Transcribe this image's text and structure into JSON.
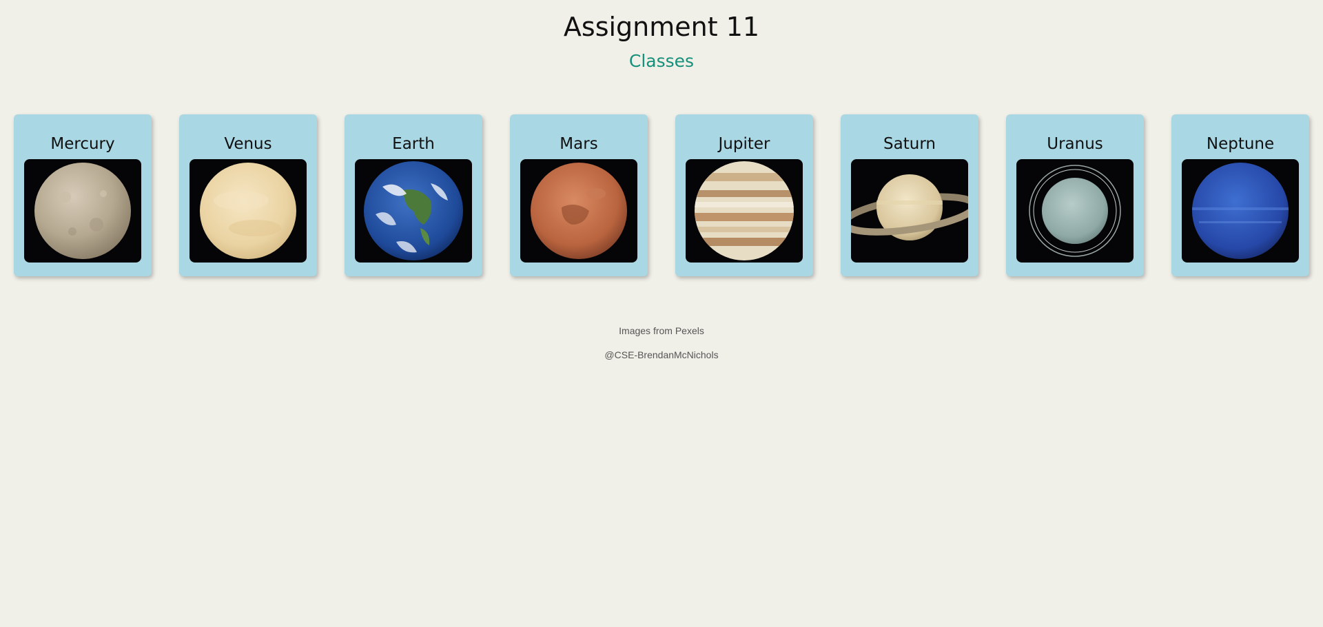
{
  "header": {
    "title": "Assignment 11",
    "subtitle": "Classes"
  },
  "planets": [
    {
      "name": "Mercury",
      "icon": "mercury-image"
    },
    {
      "name": "Venus",
      "icon": "venus-image"
    },
    {
      "name": "Earth",
      "icon": "earth-image"
    },
    {
      "name": "Mars",
      "icon": "mars-image"
    },
    {
      "name": "Jupiter",
      "icon": "jupiter-image"
    },
    {
      "name": "Saturn",
      "icon": "saturn-image"
    },
    {
      "name": "Uranus",
      "icon": "uranus-image"
    },
    {
      "name": "Neptune",
      "icon": "neptune-image"
    }
  ],
  "footer": {
    "credit": "Images from Pexels",
    "author": "@CSE-BrendanMcNichols"
  },
  "colors": {
    "background": "#f0efe8",
    "card": "#aad7e4",
    "subtitle": "#16907a"
  }
}
